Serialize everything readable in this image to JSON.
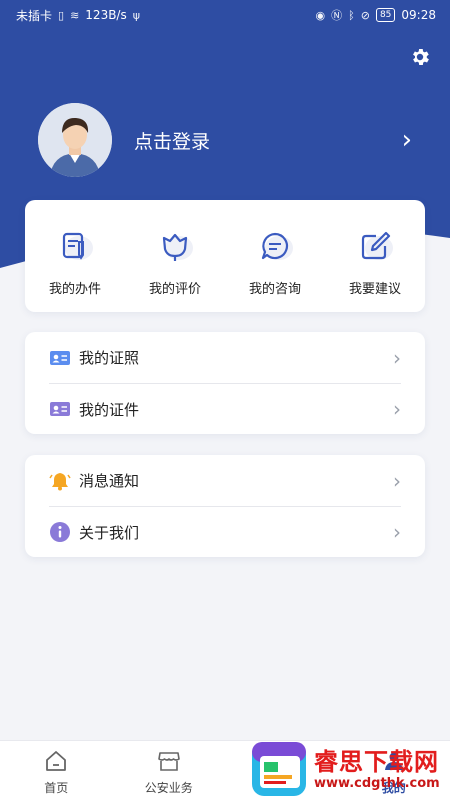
{
  "status_bar": {
    "carrier": "未插卡",
    "speed": "123B/s",
    "battery": "85",
    "time": "09:28"
  },
  "profile": {
    "login_text": "点击登录"
  },
  "quick_actions": [
    {
      "label": "我的办件",
      "icon": "document-edit-icon"
    },
    {
      "label": "我的评价",
      "icon": "lotus-icon"
    },
    {
      "label": "我的咨询",
      "icon": "chat-bubble-icon"
    },
    {
      "label": "我要建议",
      "icon": "pencil-square-icon"
    }
  ],
  "license_list": [
    {
      "label": "我的证照",
      "icon": "id-card-icon"
    },
    {
      "label": "我的证件",
      "icon": "id-card-purple-icon"
    }
  ],
  "info_list": [
    {
      "label": "消息通知",
      "icon": "bell-icon"
    },
    {
      "label": "关于我们",
      "icon": "info-icon"
    }
  ],
  "tabbar": [
    {
      "label": "首页",
      "icon": "home-icon"
    },
    {
      "label": "公安业务",
      "icon": "store-icon"
    },
    {
      "label": "",
      "icon": "tab-icon"
    },
    {
      "label": "我的",
      "icon": "user-icon"
    }
  ],
  "watermark": {
    "title": "睿思下载网",
    "url": "www.cdgthk.com"
  },
  "colors": {
    "brand_blue": "#2e4da3",
    "accent": "#3b5bc0",
    "background": "#f3f4f8"
  }
}
